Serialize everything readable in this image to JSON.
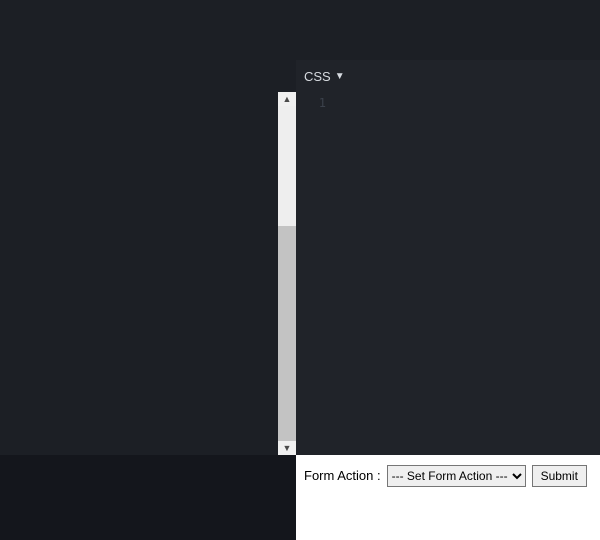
{
  "editor": {
    "pane_title": "CSS",
    "line_number": "1",
    "code": ""
  },
  "form": {
    "label": "Form Action :",
    "select_placeholder": "--- Set Form Action ---",
    "options": [
      "--- Set Form Action ---"
    ],
    "submit_label": "Submit"
  }
}
